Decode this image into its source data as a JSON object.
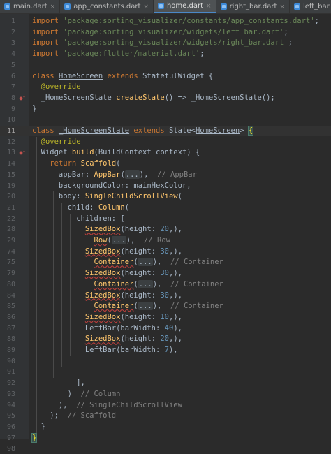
{
  "tabs": [
    {
      "label": "main.dart",
      "active": false
    },
    {
      "label": "app_constants.dart",
      "active": false
    },
    {
      "label": "home.dart",
      "active": true
    },
    {
      "label": "right_bar.dart",
      "active": false
    },
    {
      "label": "left_bar.dart",
      "active": false
    }
  ],
  "close_glyph": "×",
  "editor": {
    "current_line": "11",
    "lines": [
      {
        "n": "1",
        "t": "import 'package:sorting_visualizer/constants/app_constants.dart';"
      },
      {
        "n": "2",
        "t": "import 'package:sorting_visualizer/widgets/left_bar.dart';"
      },
      {
        "n": "3",
        "t": "import 'package:sorting_visualizer/widgets/right_bar.dart';"
      },
      {
        "n": "4",
        "t": "import 'package:flutter/material.dart';"
      },
      {
        "n": "5",
        "t": ""
      },
      {
        "n": "6",
        "t": "class HomeScreen extends StatefulWidget {"
      },
      {
        "n": "7",
        "t": "  @override"
      },
      {
        "n": "8",
        "t": "  _HomeScreenState createState() => _HomeScreenState();"
      },
      {
        "n": "9",
        "t": "}"
      },
      {
        "n": "10",
        "t": ""
      },
      {
        "n": "11",
        "t": "class _HomeScreenState extends State<HomeScreen> {"
      },
      {
        "n": "12",
        "t": "  @override"
      },
      {
        "n": "13",
        "t": "  Widget build(BuildContext context) {"
      },
      {
        "n": "14",
        "t": "    return Scaffold("
      },
      {
        "n": "15",
        "t": "      appBar: AppBar(...),  // AppBar"
      },
      {
        "n": "19",
        "t": "      backgroundColor: mainHexColor,"
      },
      {
        "n": "20",
        "t": "      body: SingleChildScrollView("
      },
      {
        "n": "21",
        "t": "        child: Column("
      },
      {
        "n": "22",
        "t": "          children: ["
      },
      {
        "n": "28",
        "t": "            SizedBox(height: 20,),"
      },
      {
        "n": "29",
        "t": "              Row(...),  // Row"
      },
      {
        "n": "74",
        "t": "            SizedBox(height: 30,),"
      },
      {
        "n": "75",
        "t": "              Container(...),  // Container"
      },
      {
        "n": "79",
        "t": "            SizedBox(height: 30,),"
      },
      {
        "n": "80",
        "t": "              Container(...),  // Container"
      },
      {
        "n": "84",
        "t": "            SizedBox(height: 30,),"
      },
      {
        "n": "85",
        "t": "              Container(...),  // Container"
      },
      {
        "n": "86",
        "t": "            SizedBox(height: 10,),"
      },
      {
        "n": "87",
        "t": "            LeftBar(barWidth: 40),"
      },
      {
        "n": "88",
        "t": "            SizedBox(height: 20,),"
      },
      {
        "n": "89",
        "t": "            LeftBar(barWidth: 7),"
      },
      {
        "n": "90",
        "t": ""
      },
      {
        "n": "91",
        "t": ""
      },
      {
        "n": "92",
        "t": "          ],"
      },
      {
        "n": "93",
        "t": "        )  // Column"
      },
      {
        "n": "94",
        "t": "      ),  // SingleChildScrollView"
      },
      {
        "n": "95",
        "t": "    );  // Scaffold"
      },
      {
        "n": "96",
        "t": "  }"
      },
      {
        "n": "97",
        "t": "}"
      },
      {
        "n": "98",
        "t": ""
      }
    ]
  }
}
